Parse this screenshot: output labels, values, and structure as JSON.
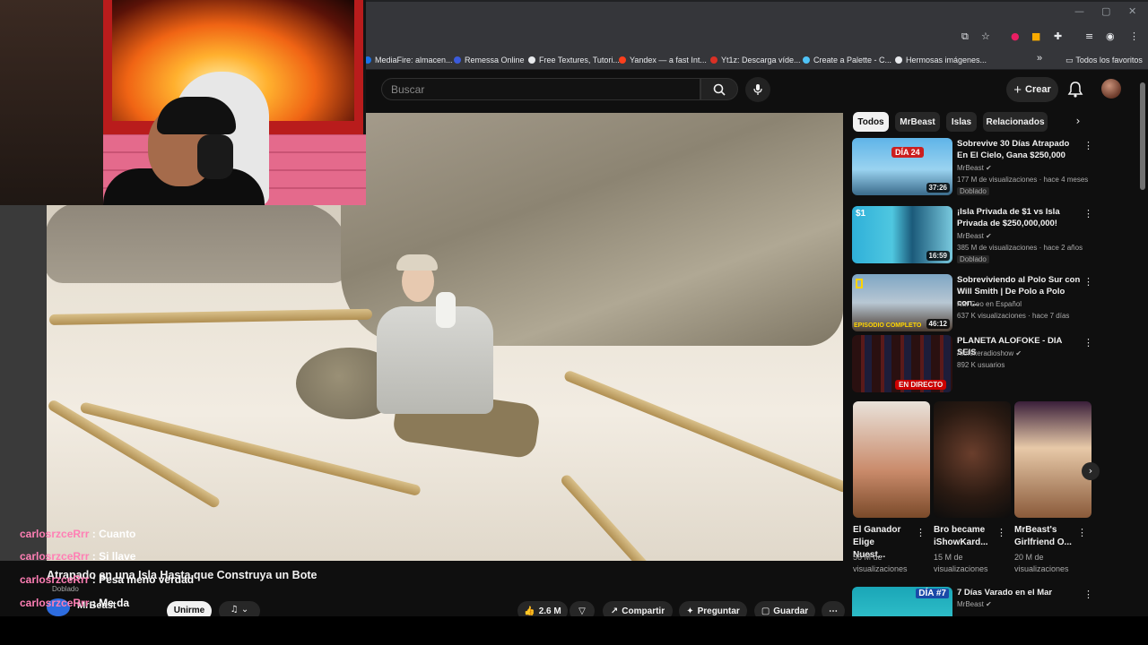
{
  "browser": {
    "window_controls": [
      "—",
      "▢",
      "✕"
    ],
    "bookmarks": [
      {
        "label": "MediaFire: almacen...",
        "color": "#1a73e8"
      },
      {
        "label": "Remessa Online",
        "color": "#3b5bdb"
      },
      {
        "label": "Free Textures, Tutori...",
        "color": "#e8eaed"
      },
      {
        "label": "Yandex — a fast Int...",
        "color": "#fc3f1d"
      },
      {
        "label": "Yt1z: Descarga víde...",
        "color": "#d93025"
      },
      {
        "label": "Create a Palette - C...",
        "color": "#4fc3f7"
      },
      {
        "label": "Hermosas imágenes...",
        "color": "#e8eaed"
      }
    ],
    "bookmarks_more": "»",
    "all_bookmarks": "Todos los favoritos"
  },
  "header": {
    "search_placeholder": "Buscar",
    "create_label": "Crear"
  },
  "video": {
    "title": "Atrapado en una Isla Hasta que Construya un Bote",
    "dubbed": "Doblado",
    "channel": "MrBeast",
    "subscribe": "Unirme",
    "likes": "2.6 M",
    "share": "Compartir",
    "ask": "Preguntar",
    "save": "Guardar",
    "more": "⋯"
  },
  "chat": [
    {
      "user": "carlosrzceRrr",
      "message": ": Cuanto"
    },
    {
      "user": "carlosrzceRrr",
      "message": ": Si llave"
    },
    {
      "user": "carlosrzceRrr",
      "message": ": Pesa meno verdad"
    },
    {
      "user": "carlosrzceRrr",
      "message": ": Me da"
    }
  ],
  "sidebar": {
    "chips": [
      "Todos",
      "MrBeast",
      "Islas",
      "Relacionados"
    ],
    "recommendations": [
      {
        "title": "Sobrevive 30 Días Atrapado En El Cielo, Gana $250,000",
        "channel": "MrBeast",
        "meta": "177 M de visualizaciones · hace 4 meses",
        "badge": "Doblado",
        "duration": "37:26",
        "thumb_label": "DÍA 24"
      },
      {
        "title": "¡Isla Privada de $1 vs Isla Privada de $250,000,000!",
        "channel": "MrBeast",
        "meta": "385 M de visualizaciones · hace 2 años",
        "badge": "Doblado",
        "duration": "16:59",
        "thumb_label": "$1"
      },
      {
        "title": "Sobreviviendo al Polo Sur con Will Smith | De Polo a Polo con...",
        "channel": "Nat Geo en Español",
        "meta": "637 K visualizaciones · hace 7 días",
        "badge": "",
        "duration": "46:12",
        "thumb_label": "EPISODIO COMPLETO"
      },
      {
        "title": "PLANETA ALOFOKE - DIA SEIS",
        "channel": "Alofokeradioshow",
        "meta": "892 K usuarios",
        "badge": "",
        "duration": "",
        "thumb_label": "EN DIRECTO"
      }
    ],
    "shorts": [
      {
        "title": "El Ganador Elige Nuest...",
        "meta": "56 M de visualizaciones"
      },
      {
        "title": "Bro became iShowKard...",
        "meta": "15 M de visualizaciones"
      },
      {
        "title": "MrBeast's Girlfriend O...",
        "meta": "20 M de visualizaciones"
      }
    ],
    "next_rec": {
      "title": "7 Días Varado en el Mar",
      "channel": "MrBeast",
      "thumb_label": "DÍA #7"
    }
  }
}
